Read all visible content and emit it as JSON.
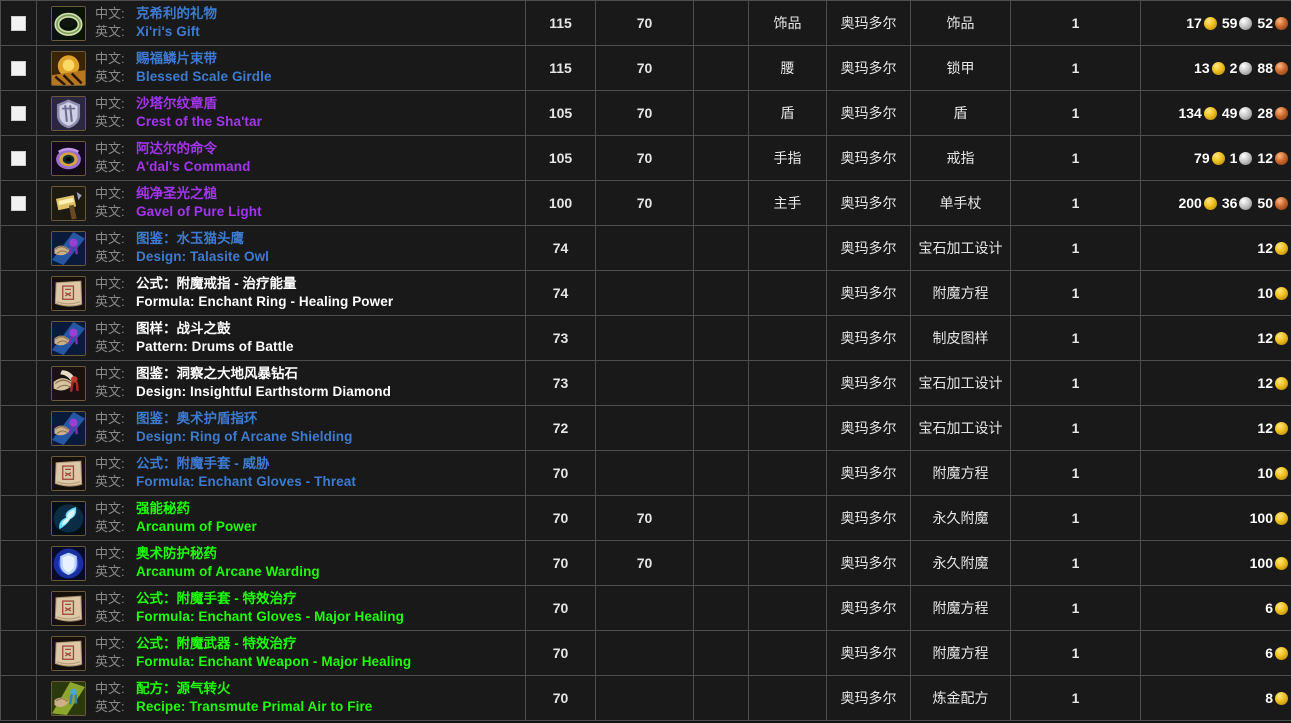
{
  "table": {
    "lang_labels": {
      "zh": "中文:",
      "en": "英文:"
    },
    "quality_colors": {
      "common": "#ffffff",
      "uncommon": "#1eff00",
      "rare": "#3d7bd1",
      "epic": "#a335ee"
    },
    "coin_labels": {
      "gold": "gold-coin",
      "silver": "silver-coin",
      "copper": "copper-coin"
    },
    "rows": [
      {
        "checkbox": true,
        "icon": "ring-jade-icon",
        "quality": "rare",
        "name_zh": "克希利的礼物",
        "name_en": "Xi'ri's Gift",
        "item_level": "115",
        "req_level": "70",
        "blank": "",
        "slot": "饰品",
        "source": "奥玛多尔",
        "type": "饰品",
        "qty": "1",
        "price": {
          "gold": "17",
          "silver": "59",
          "copper": "52"
        }
      },
      {
        "checkbox": true,
        "icon": "belt-gold-icon",
        "quality": "rare",
        "name_zh": "赐福鳞片束带",
        "name_en": "Blessed Scale Girdle",
        "item_level": "115",
        "req_level": "70",
        "blank": "",
        "slot": "腰",
        "source": "奥玛多尔",
        "type": "锁甲",
        "qty": "1",
        "price": {
          "gold": "13",
          "silver": "2",
          "copper": "88"
        }
      },
      {
        "checkbox": true,
        "icon": "shield-crest-icon",
        "quality": "epic",
        "name_zh": "沙塔尔纹章盾",
        "name_en": "Crest of the Sha'tar",
        "item_level": "105",
        "req_level": "70",
        "blank": "",
        "slot": "盾",
        "source": "奥玛多尔",
        "type": "盾",
        "qty": "1",
        "price": {
          "gold": "134",
          "silver": "49",
          "copper": "28"
        }
      },
      {
        "checkbox": true,
        "icon": "ring-eye-icon",
        "quality": "epic",
        "name_zh": "阿达尔的命令",
        "name_en": "A'dal's Command",
        "item_level": "105",
        "req_level": "70",
        "blank": "",
        "slot": "手指",
        "source": "奥玛多尔",
        "type": "戒指",
        "qty": "1",
        "price": {
          "gold": "79",
          "silver": "1",
          "copper": "12"
        }
      },
      {
        "checkbox": true,
        "icon": "mace-gavel-icon",
        "quality": "epic",
        "name_zh": "纯净圣光之槌",
        "name_en": "Gavel of Pure Light",
        "item_level": "100",
        "req_level": "70",
        "blank": "",
        "slot": "主手",
        "source": "奥玛多尔",
        "type": "单手杖",
        "qty": "1",
        "price": {
          "gold": "200",
          "silver": "36",
          "copper": "50"
        }
      },
      {
        "checkbox": false,
        "icon": "scroll-purple-icon",
        "quality": "rare",
        "name_zh": "图鉴：水玉猫头鹰",
        "name_en": "Design: Talasite Owl",
        "item_level": "74",
        "req_level": "",
        "blank": "",
        "slot": "",
        "source": "奥玛多尔",
        "type": "宝石加工设计",
        "qty": "1",
        "price": {
          "gold": "12"
        }
      },
      {
        "checkbox": false,
        "icon": "parchment-icon",
        "quality": "common",
        "name_zh": "公式：附魔戒指 - 治疗能量",
        "name_en": "Formula: Enchant Ring - Healing Power",
        "item_level": "74",
        "req_level": "",
        "blank": "",
        "slot": "",
        "source": "奥玛多尔",
        "type": "附魔方程",
        "qty": "1",
        "price": {
          "gold": "10"
        }
      },
      {
        "checkbox": false,
        "icon": "scroll-purple-icon",
        "quality": "common",
        "name_zh": "图样：战斗之鼓",
        "name_en": "Pattern: Drums of Battle",
        "item_level": "73",
        "req_level": "",
        "blank": "",
        "slot": "",
        "source": "奥玛多尔",
        "type": "制皮图样",
        "qty": "1",
        "price": {
          "gold": "12"
        }
      },
      {
        "checkbox": false,
        "icon": "scroll-red-icon",
        "quality": "common",
        "name_zh": "图鉴：洞察之大地风暴钻石",
        "name_en": "Design: Insightful Earthstorm Diamond",
        "item_level": "73",
        "req_level": "",
        "blank": "",
        "slot": "",
        "source": "奥玛多尔",
        "type": "宝石加工设计",
        "qty": "1",
        "price": {
          "gold": "12"
        }
      },
      {
        "checkbox": false,
        "icon": "scroll-purple-icon",
        "quality": "rare",
        "name_zh": "图鉴：奥术护盾指环",
        "name_en": "Design: Ring of Arcane Shielding",
        "item_level": "72",
        "req_level": "",
        "blank": "",
        "slot": "",
        "source": "奥玛多尔",
        "type": "宝石加工设计",
        "qty": "1",
        "price": {
          "gold": "12"
        }
      },
      {
        "checkbox": false,
        "icon": "parchment-icon",
        "quality": "rare",
        "name_zh": "公式：附魔手套 - 威胁",
        "name_en": "Formula: Enchant Gloves - Threat",
        "item_level": "70",
        "req_level": "",
        "blank": "",
        "slot": "",
        "source": "奥玛多尔",
        "type": "附魔方程",
        "qty": "1",
        "price": {
          "gold": "10"
        }
      },
      {
        "checkbox": false,
        "icon": "arcanum-power-icon",
        "quality": "uncommon",
        "name_zh": "强能秘药",
        "name_en": "Arcanum of Power",
        "item_level": "70",
        "req_level": "70",
        "blank": "",
        "slot": "",
        "source": "奥玛多尔",
        "type": "永久附魔",
        "qty": "1",
        "price": {
          "gold": "100"
        }
      },
      {
        "checkbox": false,
        "icon": "arcanum-warding-icon",
        "quality": "uncommon",
        "name_zh": "奥术防护秘药",
        "name_en": "Arcanum of Arcane Warding",
        "item_level": "70",
        "req_level": "70",
        "blank": "",
        "slot": "",
        "source": "奥玛多尔",
        "type": "永久附魔",
        "qty": "1",
        "price": {
          "gold": "100"
        }
      },
      {
        "checkbox": false,
        "icon": "parchment-icon",
        "quality": "uncommon",
        "name_zh": "公式：附魔手套 - 特效治疗",
        "name_en": "Formula: Enchant Gloves - Major Healing",
        "item_level": "70",
        "req_level": "",
        "blank": "",
        "slot": "",
        "source": "奥玛多尔",
        "type": "附魔方程",
        "qty": "1",
        "price": {
          "gold": "6"
        }
      },
      {
        "checkbox": false,
        "icon": "parchment-icon",
        "quality": "uncommon",
        "name_zh": "公式：附魔武器 - 特效治疗",
        "name_en": "Formula: Enchant Weapon - Major Healing",
        "item_level": "70",
        "req_level": "",
        "blank": "",
        "slot": "",
        "source": "奥玛多尔",
        "type": "附魔方程",
        "qty": "1",
        "price": {
          "gold": "6"
        }
      },
      {
        "checkbox": false,
        "icon": "recipe-transmute-icon",
        "quality": "uncommon",
        "name_zh": "配方：源气转火",
        "name_en": "Recipe: Transmute Primal Air to Fire",
        "item_level": "70",
        "req_level": "",
        "blank": "",
        "slot": "",
        "source": "奥玛多尔",
        "type": "炼金配方",
        "qty": "1",
        "price": {
          "gold": "8"
        }
      }
    ]
  }
}
